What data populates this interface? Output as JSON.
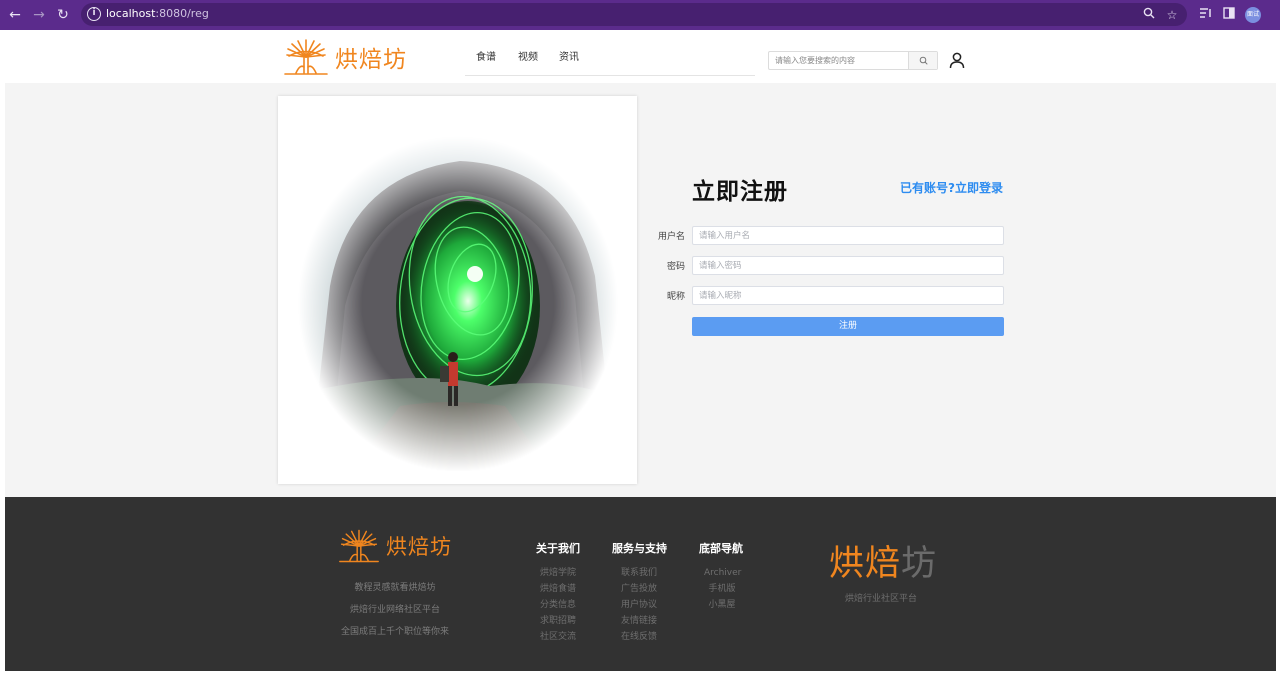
{
  "browser": {
    "url_host": "localhost",
    "url_path": ":8080/reg",
    "profile_label": "面试"
  },
  "header": {
    "logo_text": "烘焙坊",
    "nav": [
      "食谱",
      "视频",
      "资讯"
    ],
    "search_placeholder": "请输入您要搜索的内容"
  },
  "register": {
    "title": "立即注册",
    "login_link": "已有账号?立即登录",
    "fields": [
      {
        "label": "用户名",
        "placeholder": "请输入用户名"
      },
      {
        "label": "密码",
        "placeholder": "请输入密码"
      },
      {
        "label": "昵称",
        "placeholder": "请输入昵称"
      }
    ],
    "submit_label": "注册"
  },
  "footer": {
    "logo_text": "烘焙坊",
    "slogans": [
      "教程灵感就看烘焙坊",
      "烘焙行业网络社区平台",
      "全国成百上千个职位等你来"
    ],
    "columns": [
      {
        "title": "关于我们",
        "links": [
          "烘焙学院",
          "烘焙食谱",
          "分类信息",
          "求职招聘",
          "社区交流"
        ]
      },
      {
        "title": "服务与支持",
        "links": [
          "联系我们",
          "广告投放",
          "用户协议",
          "友情链接",
          "在线反馈"
        ]
      },
      {
        "title": "底部导航",
        "links": [
          "Archiver",
          "手机版",
          "小黑屋"
        ]
      }
    ],
    "brand_part1": "烘焙",
    "brand_part2": "坊",
    "brand_sub": "烘焙行业社区平台"
  },
  "colors": {
    "chrome": "#5b2b8c",
    "brand_orange": "#f0861f",
    "accent_blue": "#2d8cf0",
    "button_blue": "#5b9cf2",
    "footer_bg": "#323232"
  }
}
